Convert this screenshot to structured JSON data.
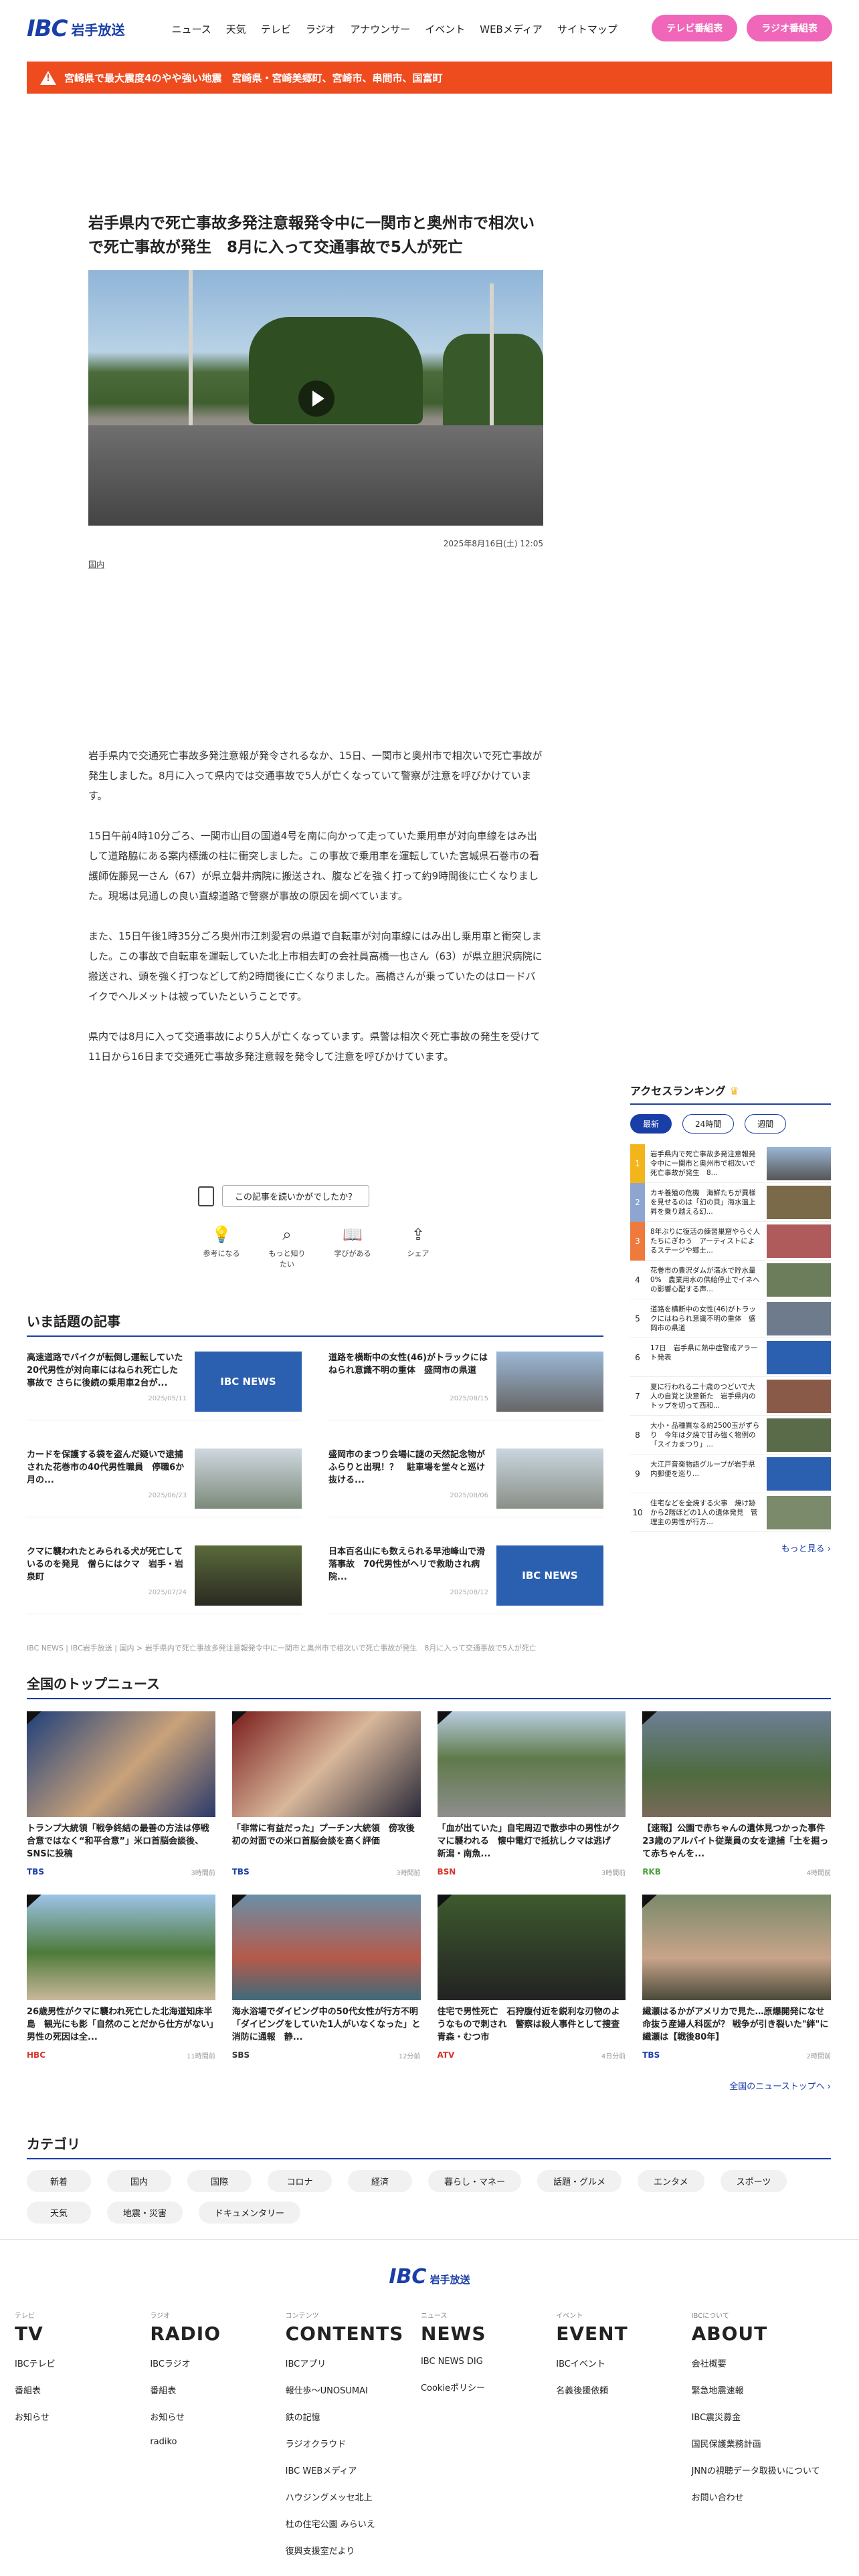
{
  "header": {
    "logo_mark": "IBC",
    "logo_name": "岩手放送",
    "nav": [
      "ニュース",
      "天気",
      "テレビ",
      "ラジオ",
      "アナウンサー",
      "イベント",
      "WEBメディア",
      "サイトマップ"
    ],
    "tv_btn": "テレビ番組表",
    "radio_btn": "ラジオ番組表"
  },
  "alert": {
    "text": "宮崎県で最大震度4のやや強い地震　宮崎県・宮崎美郷町、宮崎市、串間市、国富町"
  },
  "article": {
    "title": "岩手県内で死亡事故多発注意報発令中に一関市と奥州市で相次いで死亡事故が発生　8月に入って交通事故で5人が死亡",
    "date": "2025年8月16日(土) 12:05",
    "category": "国内",
    "paragraphs": [
      "岩手県内で交通死亡事故多発注意報が発令されるなか、15日、一関市と奥州市で相次いで死亡事故が発生しました。8月に入って県内では交通事故で5人が亡くなっていて警察が注意を呼びかけています。",
      "15日午前4時10分ごろ、一関市山目の国道4号を南に向かって走っていた乗用車が対向車線をはみ出して道路脇にある案内標識の柱に衝突しました。この事故で乗用車を運転していた宮城県石巻市の看護師佐藤晃一さん（67）が県立磐井病院に搬送され、腹などを強く打って約9時間後に亡くなりました。現場は見通しの良い直線道路で警察が事故の原因を調べています。",
      "また、15日午後1時35分ごろ奥州市江刺愛宕の県道で自転車が対向車線にはみ出し乗用車と衝突しました。この事故で自転車を運転していた北上市相去町の会社員高橋一也さん（63）が県立胆沢病院に搬送され、頭を強く打つなどして約2時間後に亡くなりました。高橋さんが乗っていたのはロードバイクでヘルメットは被っていたということです。",
      "県内では8月に入って交通事故により5人が亡くなっています。県警は相次ぐ死亡事故の発生を受けて11日から16日まで交通死亡事故多発注意報を発令して注意を呼びかけています。"
    ],
    "feedback_q": "この記事を読いかがでしたか？",
    "reactions": [
      "参考になる",
      "もっと知りたい",
      "学びがある",
      "シェア"
    ]
  },
  "ranking": {
    "title": "アクセスランキング",
    "tabs": [
      "最新",
      "24時間",
      "週間"
    ],
    "items": [
      "岩手県内で死亡事故多発注意報発令中に一関市と奥州市で相次いで死亡事故が発生　8...",
      "カキ養殖の危機　海鮮たちが異様を見せるのは「幻の貝」海水温上昇を乗り越える幻...",
      "8年ぶりに復活の練習巣窟やらぐ人たちにぎわう　アーティストによるステージや郷土...",
      "花巻市の豊沢ダムが満水で貯水量0%　農業用水の供給停止でイネへの影響心配する声...",
      "道路を横断中の女性(46)がトラックにはねられ意識不明の重体　盛岡市の県道",
      "17日　岩手県に熱中症警戒アラート発表",
      "夏に行われる二十歳のつどいで大人の自覚と決意新た　岩手県内のトップを切って西和...",
      "大小・品種異なる約2500玉がずらり　今年は夕焼で甘み強く物例の「スイカまつり」...",
      "大江戸音楽物語グループが岩手県内郵便を巡り...",
      "住宅などを全焼する火事　焼け跡から2階ほどの1人の遺体発見　管理主の男性が行方..."
    ],
    "more": "もっと見る"
  },
  "hot": {
    "title": "いま話題の記事",
    "items": [
      {
        "title": "高速道路でバイクが転倒し運転していた20代男性が対向車にはねられ死亡した事故で さらに後続の乗用車2台が...",
        "date": "2025/05/11"
      },
      {
        "title": "道路を横断中の女性(46)がトラックにはねられ意識不明の重体　盛岡市の県道",
        "date": "2025/08/15"
      },
      {
        "title": "カードを保護する袋を盗んだ疑いで逮捕された花巻市の40代男性職員　停職6か月の...",
        "date": "2025/06/23"
      },
      {
        "title": "盛岡市のまつり会場に謎の天然記念物がふらりと出現！？　駐車場を堂々と巡け抜ける...",
        "date": "2025/08/06"
      },
      {
        "title": "クマに襲われたとみられる犬が死亡しているのを発見　僧らにはクマ　岩手・岩泉町",
        "date": "2025/07/24"
      },
      {
        "title": "日本百名山にも数えられる早池峰山で滑落事故　70代男性がヘリで救助され病院...",
        "date": "2025/08/12"
      }
    ],
    "thumb_label": "IBC NEWS"
  },
  "breadcrumb": "IBC NEWS | IBC岩手放送 | 国内 > 岩手県内で死亡事故多発注意報発令中に一関市と奥州市で相次いで死亡事故が発生　8月に入って交通事故で5人が死亡",
  "top": {
    "title": "全国のトップニュース",
    "items": [
      {
        "title": "トランプ大統領「戦争終結の最善の方法は停戦合意ではなく“和平合意”」米ロ首脳会談後、SNSに投稿",
        "src": "TBS",
        "time": "3時間前"
      },
      {
        "title": "「非常に有益だった」プーチン大統領　傍攻後初の対面での米ロ首脳会談を高く評価",
        "src": "TBS",
        "time": "3時間前"
      },
      {
        "title": "「血が出ていた」自宅周辺で散歩中の男性がクマに襲われる　懐中電灯で抵抗しクマは逃げ　新潟・南魚...",
        "src": "BSN",
        "time": "3時間前"
      },
      {
        "title": "【速報】公園で赤ちゃんの遺体見つかった事件　23歳のアルバイト従業員の女を逮捕「土を掘って赤ちゃんを...",
        "src": "RKB",
        "time": "4時間前"
      },
      {
        "title": "26歳男性がクマに襲われ死亡した北海道知床半島　観光にも影「自然のことだから仕方がない」男性の死因は全...",
        "src": "HBC",
        "time": "11時間前"
      },
      {
        "title": "海水浴場でダイビング中の50代女性が行方不明「ダイビングをしていた1人がいなくなった」と消防に通報　静...",
        "src": "SBS",
        "time": "12分前"
      },
      {
        "title": "住宅で男性死亡　石狩腹付近を鋭利な刃物のようなもので刺され　警察は殺人事件として捜査　青森・むつ市",
        "src": "ATV",
        "time": "4日分前"
      },
      {
        "title": "繊瀬はるかがアメリカで見た…原爆開発になせ命抜う産婦人科医が？ 戦争が引き裂いた\"絆\"に繊瀬は【戦後80年】",
        "src": "TBS",
        "time": "2時間前"
      }
    ],
    "more": "全国のニューストップへ"
  },
  "category": {
    "title": "カテゴリ",
    "chips": [
      "新着",
      "国内",
      "国際",
      "コロナ",
      "経済",
      "暮らし・マネー",
      "話題・グルメ",
      "エンタメ",
      "スポーツ",
      "天気",
      "地震・災害",
      "ドキュメンタリー"
    ]
  },
  "footer": {
    "logo_mark": "IBC",
    "logo_name": "岩手放送",
    "cols": [
      {
        "sm": "テレビ",
        "big": "TV",
        "links": [
          "IBCテレビ",
          "番組表",
          "お知らせ"
        ]
      },
      {
        "sm": "ラジオ",
        "big": "RADIO",
        "links": [
          "IBCラジオ",
          "番組表",
          "お知らせ",
          "radiko"
        ]
      },
      {
        "sm": "コンテンツ",
        "big": "CONTENTS",
        "links": [
          "IBCアプリ",
          "報仕歩〜UNOSUMAI",
          "鉄の記憶",
          "ラジオクラウド",
          "IBC WEBメディア",
          "ハウジングメッセ北上",
          "杜の住宅公園 みらいえ",
          "復興支援室だより"
        ]
      },
      {
        "sm": "ニュース",
        "big": "NEWS",
        "links": [
          "IBC NEWS DIG",
          "Cookieポリシー"
        ]
      },
      {
        "sm": "イベント",
        "big": "EVENT",
        "links": [
          "IBCイベント",
          "名義後援依頼"
        ]
      },
      {
        "sm": "IBCについて",
        "big": "ABOUT",
        "links": [
          "会社概要",
          "緊急地震速報",
          "IBC震災募金",
          "国民保護業務計画",
          "JNNの視聴データ取扱いについて",
          "お問い合わせ"
        ]
      }
    ]
  }
}
